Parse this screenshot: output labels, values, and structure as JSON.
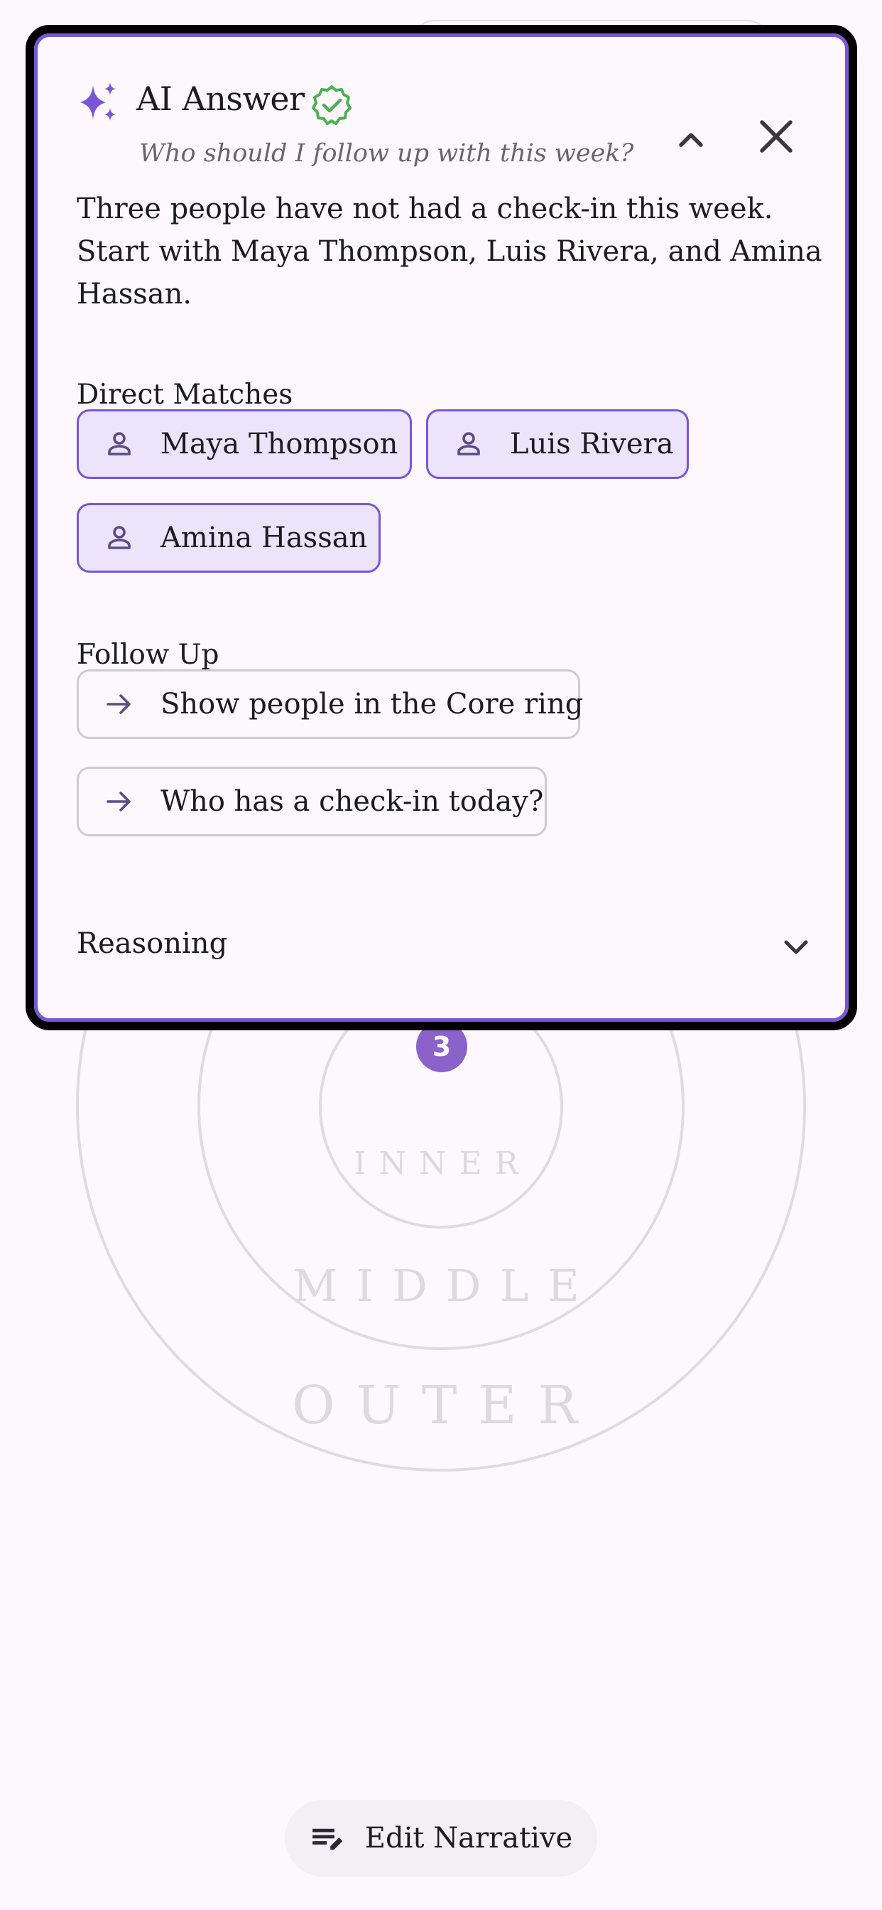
{
  "panel": {
    "title": "AI Answer",
    "question": "Who should I follow up with this week?",
    "answer": "Three people have not had a check-in this week. Start with Maya Thompson, Luis Rivera, and Amina Hassan.",
    "direct_matches_title": "Direct Matches",
    "direct_matches": [
      {
        "label": "Maya Thompson",
        "icon": "person-icon"
      },
      {
        "label": "Luis Rivera",
        "icon": "person-icon"
      },
      {
        "label": "Amina Hassan",
        "icon": "person-icon"
      }
    ],
    "follow_up_title": "Follow Up",
    "follow_ups": [
      {
        "label": "Show people in the Core ring",
        "icon": "arrow-right-icon"
      },
      {
        "label": "Who has a check-in today?",
        "icon": "arrow-right-icon"
      }
    ],
    "reasoning_label": "Reasoning",
    "icons": {
      "title": "sparkle-icon",
      "verified": "verified-badge-icon",
      "collapse": "chevron-up-icon",
      "close": "close-icon",
      "reasoning": "chevron-down-icon"
    }
  },
  "rings": {
    "labels": [
      "INNER",
      "MIDDLE",
      "OUTER"
    ],
    "badge_count": "3"
  },
  "bottom": {
    "edit_label": "Edit Narrative",
    "edit_icon": "edit-notes-icon"
  },
  "colors": {
    "accent": "#7a55d8",
    "chip_fill": "#ece4fb",
    "verified": "#4caf50",
    "badge": "#8a62c9",
    "background": "#fdf8fd"
  }
}
